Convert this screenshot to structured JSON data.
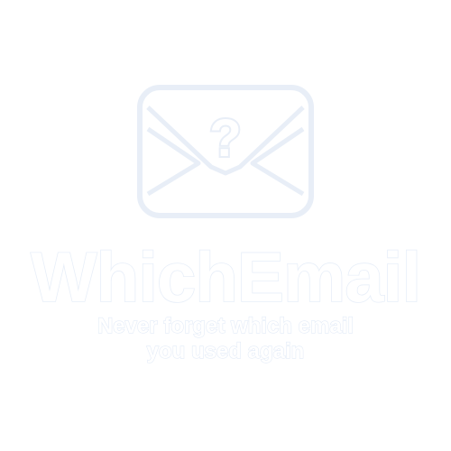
{
  "brand": {
    "name": "WhichEmail",
    "tagline_line1": "Never forget which email",
    "tagline_line2": "you used again"
  },
  "logo": {
    "icon": "envelope-question-icon",
    "glyph": "?"
  },
  "colors": {
    "background": "#ffffff",
    "outline": "#e7eef8",
    "fill": "#ffffff"
  }
}
